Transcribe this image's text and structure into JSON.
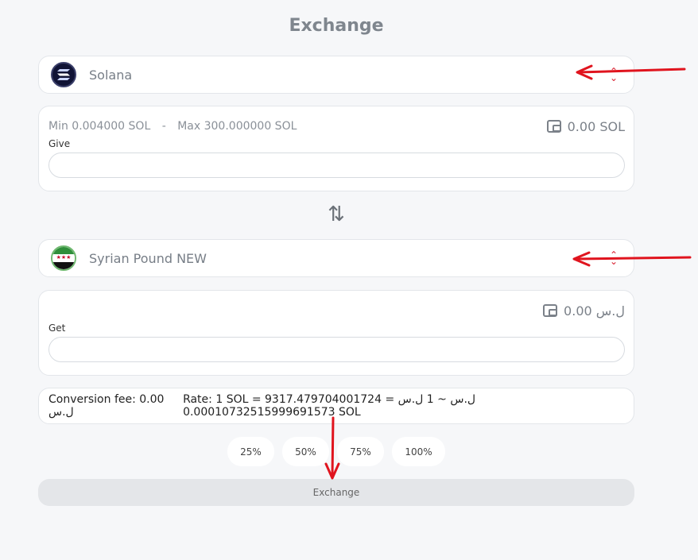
{
  "page": {
    "title": "Exchange"
  },
  "from": {
    "currency_name": "Solana",
    "min_label": "Min 0.004000 SOL",
    "separator": "-",
    "max_label": "Max 300.000000 SOL",
    "balance": "0.00 SOL",
    "field_label": "Give",
    "input_value": ""
  },
  "to": {
    "currency_name": "Syrian Pound NEW",
    "balance": "ل.س 0.00",
    "field_label": "Get",
    "input_value": ""
  },
  "info": {
    "conversion_fee": "Conversion fee: 0.00 ل.س",
    "rate": "Rate: 1 SOL = 9317.479704001724 ل.س ~ 1 ل.س = 0.00010732515999691573 SOL"
  },
  "percent_buttons": [
    "25%",
    "50%",
    "75%",
    "100%"
  ],
  "exchange_button_label": "Exchange",
  "colors": {
    "annotation_arrow": "#e0141e",
    "swap_icon": "#6b7178"
  },
  "icons": [
    "solana-logo",
    "syria-flag-icon",
    "wallet-icon",
    "swap-arrows-icon",
    "chevron-updown-icon"
  ]
}
